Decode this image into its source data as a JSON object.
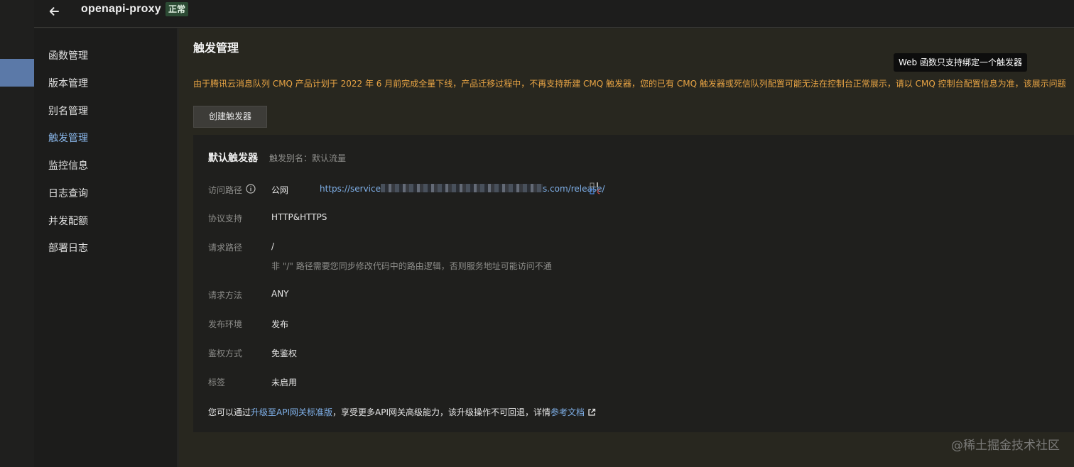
{
  "header": {
    "title": "openapi-proxy",
    "status": "正常"
  },
  "sidebar": {
    "items": [
      {
        "label": "函数管理"
      },
      {
        "label": "版本管理"
      },
      {
        "label": "别名管理"
      },
      {
        "label": "触发管理"
      },
      {
        "label": "监控信息"
      },
      {
        "label": "日志查询"
      },
      {
        "label": "并发配额"
      },
      {
        "label": "部署日志"
      }
    ],
    "active": "触发管理"
  },
  "main": {
    "title": "触发管理",
    "tooltip": "Web 函数只支持绑定一个触发器",
    "notice": "由于腾讯云消息队列 CMQ 产品计划于 2022 年 6 月前完成全量下线，产品迁移过程中，不再支持新建 CMQ 触发器，您的已有 CMQ 触发器或死信队列配置可能无法在控制台正常展示，请以 CMQ 控制台配置信息为准，该展示问题",
    "create_button": "创建触发器"
  },
  "trigger": {
    "name": "默认触发器",
    "alias": "触发别名：默认流量",
    "fields": {
      "access_path_label": "访问路径",
      "access_type": "公网",
      "url_prefix": "https://service",
      "url_suffix": "s.com/release/",
      "protocol_label": "协议支持",
      "protocol": "HTTP&HTTPS",
      "request_path_label": "请求路径",
      "request_path": "/",
      "request_path_hint": "非 \"/\" 路径需要您同步修改代码中的路由逻辑，否则服务地址可能访问不通",
      "method_label": "请求方法",
      "method": "ANY",
      "env_label": "发布环境",
      "env": "发布",
      "auth_label": "鉴权方式",
      "auth": "免鉴权",
      "tag_label": "标签",
      "tag": "未启用"
    },
    "footer": {
      "prefix": "您可以通过",
      "upgrade_link": "升级至API网关标准版",
      "middle": "，享受更多API网关高级能力，该升级操作不可回退，详情",
      "doc_link": "参考文档"
    }
  },
  "watermark": "@稀土掘金技术社区",
  "colors": {
    "accent": "#8ab8ec",
    "link": "#7fb0e9",
    "warning": "#e8a444",
    "status_bg": "#2c4b34"
  }
}
